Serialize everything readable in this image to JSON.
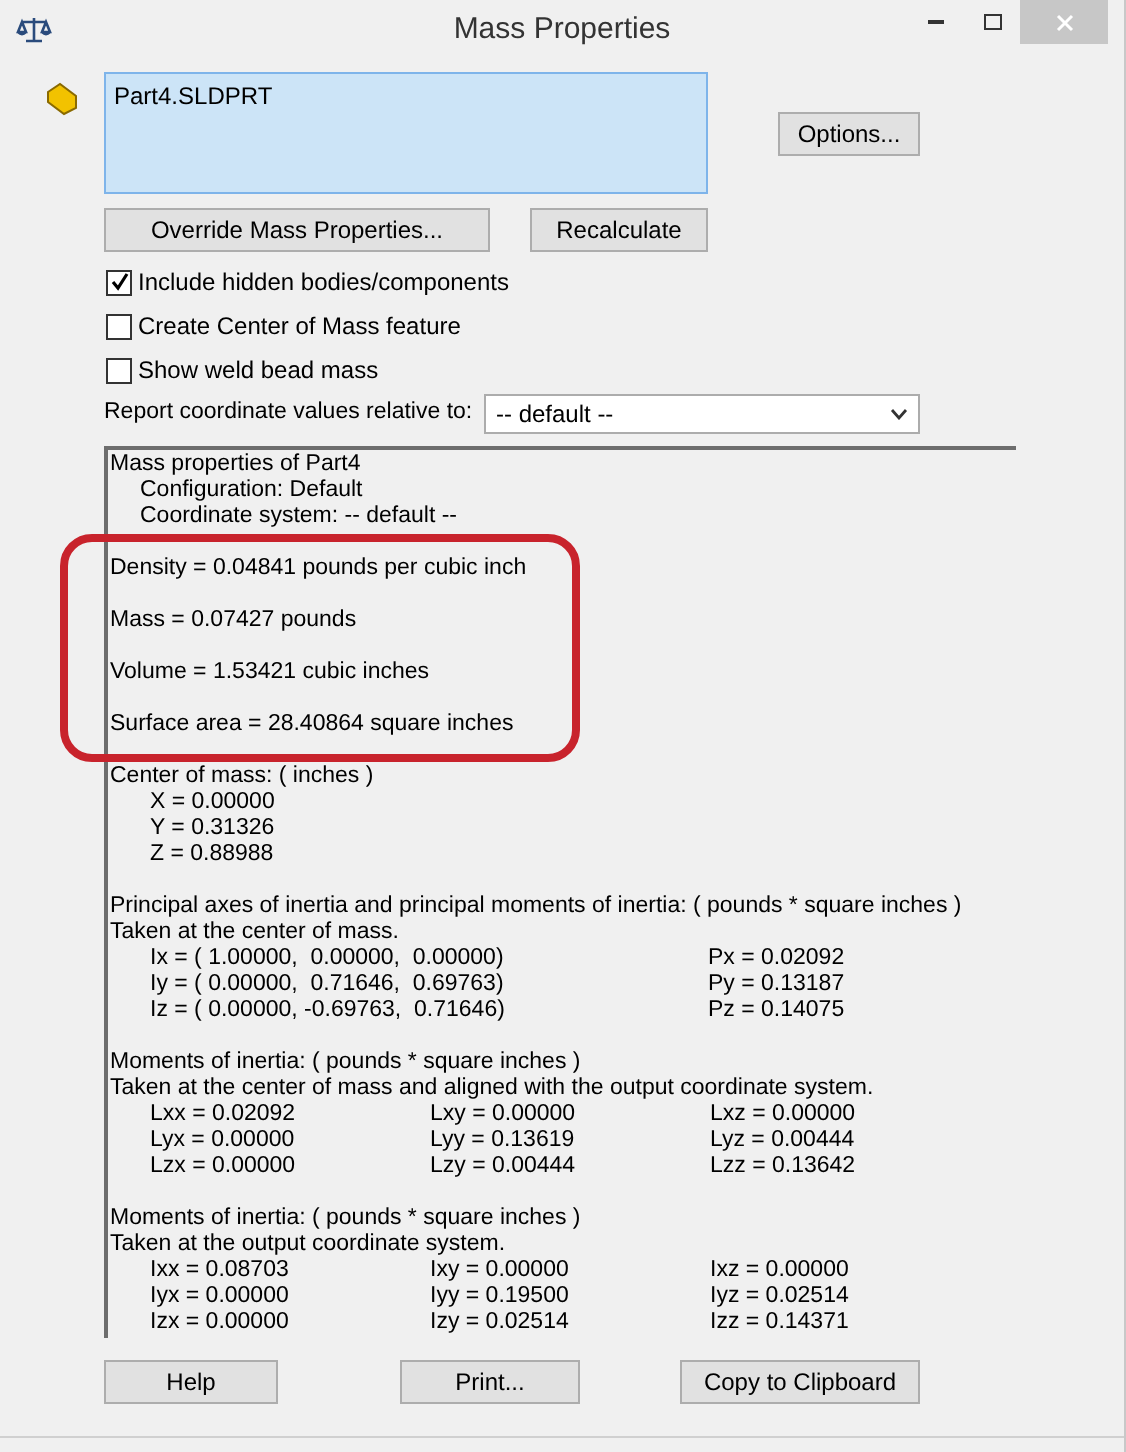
{
  "window": {
    "title": "Mass Properties"
  },
  "part_list": {
    "items": [
      {
        "label": "Part4.SLDPRT",
        "selected": true
      }
    ]
  },
  "options_button": "Options...",
  "action_buttons": [
    "Override Mass Properties...",
    "Recalculate"
  ],
  "checkboxes": [
    {
      "label": "Include hidden bodies/components",
      "checked": true
    },
    {
      "label": "Create Center of Mass feature",
      "checked": false
    },
    {
      "label": "Show weld bead mass",
      "checked": false
    }
  ],
  "report_relative": {
    "label": "Report coordinate values relative to:",
    "value": "-- default --"
  },
  "results": {
    "header": {
      "title": "Mass properties of Part4",
      "lines": [
        "Configuration: Default",
        "Coordinate system: -- default --"
      ]
    },
    "highlight_box": true,
    "highlighted": [
      "Density = 0.04841 pounds per cubic inch",
      "Mass = 0.07427 pounds",
      "Volume = 1.53421 cubic inches",
      "Surface area = 28.40864 square inches"
    ],
    "sections": [
      {
        "kind": "list",
        "title": "Center of mass: ( inches )",
        "rows": [
          [
            "X = 0.00000"
          ],
          [
            "Y = 0.31326"
          ],
          [
            "Z = 0.88988"
          ]
        ]
      },
      {
        "kind": "axes",
        "title": "Principal axes of inertia and principal moments of inertia: ( pounds * square inches )",
        "subtitle": "Taken at the center of mass.",
        "rows": [
          [
            "Ix = ( 1.00000,  0.00000,  0.00000)",
            "Px = 0.02092"
          ],
          [
            "Iy = ( 0.00000,  0.71646,  0.69763)",
            "Py = 0.13187"
          ],
          [
            "Iz = ( 0.00000, -0.69763,  0.71646)",
            "Pz = 0.14075"
          ]
        ]
      },
      {
        "kind": "matrix",
        "title": "Moments of inertia: ( pounds * square inches )",
        "subtitle": "Taken at the center of mass and aligned with the output coordinate system.",
        "rows": [
          [
            "Lxx = 0.02092",
            "Lxy = 0.00000",
            "Lxz = 0.00000"
          ],
          [
            "Lyx = 0.00000",
            "Lyy = 0.13619",
            "Lyz = 0.00444"
          ],
          [
            "Lzx = 0.00000",
            "Lzy = 0.00444",
            "Lzz = 0.13642"
          ]
        ]
      },
      {
        "kind": "matrix",
        "title": "Moments of inertia: ( pounds * square inches )",
        "subtitle": "Taken at the output coordinate system.",
        "rows": [
          [
            "Ixx = 0.08703",
            "Ixy = 0.00000",
            "Ixz = 0.00000"
          ],
          [
            "Iyx = 0.00000",
            "Iyy = 0.19500",
            "Iyz = 0.02514"
          ],
          [
            "Izx = 0.00000",
            "Izy = 0.02514",
            "Izz = 0.14371"
          ]
        ]
      }
    ]
  },
  "bottom_buttons": [
    "Help",
    "Print...",
    "Copy to Clipboard"
  ]
}
